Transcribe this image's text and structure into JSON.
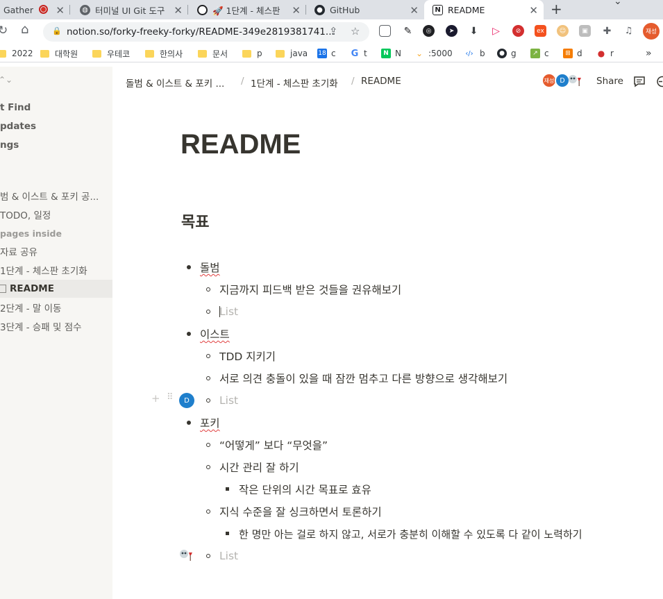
{
  "browser": {
    "tabs": [
      {
        "label": "Gather",
        "icon": "recording-icon"
      },
      {
        "label": "터미널 UI Git 도구",
        "icon": "globe-icon"
      },
      {
        "label": "🚀 1단계 - 체스판",
        "icon": "openai-icon"
      },
      {
        "label": "GitHub",
        "icon": "github-icon"
      },
      {
        "label": "README",
        "icon": "notion-icon"
      }
    ],
    "new_tab": "+",
    "url": "notion.so/forky-freeky-forky/README-349e2819381741...",
    "profile_label": "재성",
    "bookmarks": [
      {
        "label": "2022",
        "type": "folder"
      },
      {
        "label": "대학원",
        "type": "folder"
      },
      {
        "label": "우테코",
        "type": "folder"
      },
      {
        "label": "한의사",
        "type": "folder"
      },
      {
        "label": "문서",
        "type": "folder"
      },
      {
        "label": "p",
        "type": "folder"
      },
      {
        "label": "java",
        "type": "folder"
      },
      {
        "label": "c",
        "type": "calendar"
      },
      {
        "label": "t",
        "type": "google"
      },
      {
        "label": "N",
        "type": "naver"
      },
      {
        "label": ":5000",
        "type": "local"
      },
      {
        "label": "b",
        "type": "code"
      },
      {
        "label": "g",
        "type": "github"
      },
      {
        "label": "c",
        "type": "green"
      },
      {
        "label": "d",
        "type": "orange"
      },
      {
        "label": "r",
        "type": "apple"
      }
    ],
    "bookmarks_more": "»"
  },
  "sidebar": {
    "items": [
      {
        "label": "Quick Find",
        "visible": "t Find"
      },
      {
        "label": "Updates",
        "visible": "pdates"
      },
      {
        "label": "Settings",
        "visible": "ngs"
      },
      {
        "label": "돌범 & 이스트 & 포키 공...",
        "visible": "범 & 이스트 & 포키 공..."
      },
      {
        "label": "TODO, 일정",
        "visible": "TODO, 일정"
      },
      {
        "label": "pages inside",
        "visible": "pages inside"
      },
      {
        "label": "자료 공유",
        "visible": "자료 공유"
      },
      {
        "label": "1단계 - 체스판 초기화",
        "visible": "1단계 - 체스판 초기화"
      },
      {
        "label": "README",
        "visible": "README"
      },
      {
        "label": "2단계 - 말 이동",
        "visible": "2단계 - 말 이동"
      },
      {
        "label": "3단계 - 승패 및 점수",
        "visible": "3단계 - 승패 및 점수"
      }
    ]
  },
  "topbar": {
    "breadcrumbs": [
      "돌범 & 이스트 & 포키 ...",
      "1단계 - 체스판 초기화",
      "README"
    ],
    "separator": "/",
    "avatars": [
      "재성",
      "D"
    ],
    "share_label": "Share"
  },
  "page": {
    "title": "README",
    "heading": "목표",
    "blocks": [
      {
        "level": 1,
        "text": "돌범"
      },
      {
        "level": 2,
        "text": "지금까지 피드백 받은 것들을 권유해보기"
      },
      {
        "level": 2,
        "text": "List",
        "placeholder": true
      },
      {
        "level": 1,
        "text": "이스트"
      },
      {
        "level": 2,
        "text": "TDD 지키기"
      },
      {
        "level": 2,
        "text": "서로 의견 충돌이 있을 때 잠깐 멈추고 다른 방향으로 생각해보기"
      },
      {
        "level": 2,
        "text": "List",
        "placeholder": true
      },
      {
        "level": 1,
        "text": "포키"
      },
      {
        "level": 2,
        "text": "“어떻게” 보다 “무엇을”"
      },
      {
        "level": 2,
        "text": "시간 관리 잘 하기"
      },
      {
        "level": 3,
        "text": "작은 단위의 시간 목표로 효유"
      },
      {
        "level": 2,
        "text": "지식 수준을 잘 싱크하면서 토론하기"
      },
      {
        "level": 3,
        "text": "한 명만 아는 걸로 하지 않고, 서로가 충분히 이해할 수 있도록 다 같이 노력하기"
      },
      {
        "level": 2,
        "text": "List",
        "placeholder": true
      }
    ],
    "cursor_avatar": "D"
  },
  "colors": {
    "notion_text": "#37352f",
    "placeholder": "#b4b3af",
    "sidebar_bg": "#f7f6f3",
    "tab_strip": "#dee1e6",
    "avatar_blue": "#1f7fcc",
    "avatar_orange": "#e55b2d"
  }
}
